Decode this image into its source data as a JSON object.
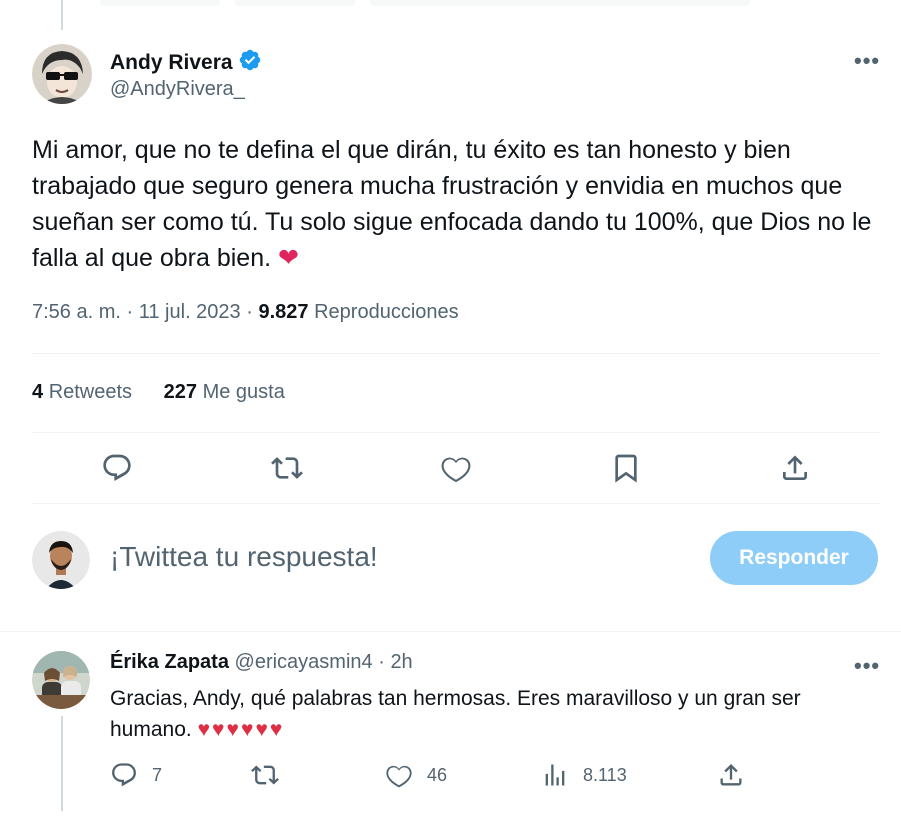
{
  "main_tweet": {
    "author_name": "Andy Rivera",
    "author_handle": "@AndyRivera_",
    "more_icon": "ellipsis-icon",
    "verified_icon": "verified-badge-icon",
    "text": "Mi amor, que no te defina el que dirán, tu éxito es tan honesto y bien trabajado que seguro genera mucha frustración y envidia en muchos que sueñan ser como tú. Tu solo sigue enfocada dando tu 100%, que Dios no le falla al que obra bien.",
    "emoji": "❤",
    "time": "7:56 a. m.",
    "sep": "·",
    "date": "11 jul. 2023",
    "views_count": "9.827",
    "views_label": "Reproducciones",
    "retweets_count": "4",
    "retweets_label": "Retweets",
    "likes_count": "227",
    "likes_label": "Me gusta"
  },
  "compose": {
    "placeholder": "¡Twittea tu respuesta!",
    "button_label": "Responder"
  },
  "reply": {
    "author_name": "Érika Zapata",
    "author_handle": "@ericayasmin4",
    "sep": "·",
    "time": "2h",
    "text": "Gracias, Andy, qué palabras tan hermosas. Eres maravilloso y un gran ser humano.",
    "hearts": "♥♥♥♥♥♥",
    "reply_count": "7",
    "like_count": "46",
    "view_count": "8.113"
  },
  "colors": {
    "accent": "#1d9bf0",
    "accent_disabled": "#8ecdf8",
    "muted": "#536471",
    "heart": "#e0245e"
  }
}
